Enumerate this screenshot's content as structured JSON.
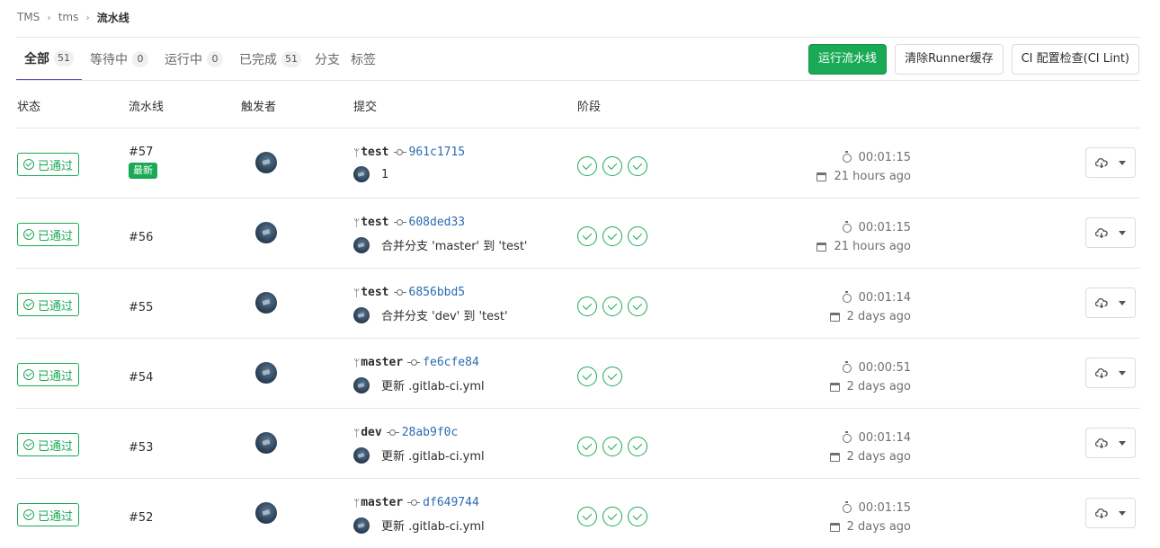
{
  "breadcrumb": {
    "items": [
      "TMS",
      "tms"
    ],
    "current": "流水线"
  },
  "tabs": [
    {
      "label": "全部",
      "count": "51",
      "active": true
    },
    {
      "label": "等待中",
      "count": "0"
    },
    {
      "label": "运行中",
      "count": "0"
    },
    {
      "label": "已完成",
      "count": "51"
    },
    {
      "label": "分支"
    },
    {
      "label": "标签"
    }
  ],
  "actions": {
    "run_pipeline": "运行流水线",
    "clear_cache": "清除Runner缓存",
    "ci_lint": "CI 配置检查(CI Lint)"
  },
  "table": {
    "headers": {
      "status": "状态",
      "pipeline": "流水线",
      "triggerer": "触发者",
      "commit": "提交",
      "stages": "阶段"
    }
  },
  "colors": {
    "success": "#1aaa55",
    "accent": "#6b4fbb"
  },
  "pipelines": [
    {
      "status": "已通过",
      "id": "#57",
      "latest": "最新",
      "ref": "test",
      "sha": "961c1715",
      "message": "1",
      "stages": 3,
      "duration": "00:01:15",
      "ago": "21 hours ago"
    },
    {
      "status": "已通过",
      "id": "#56",
      "ref": "test",
      "sha": "608ded33",
      "message": "合并分支 'master' 到 'test'",
      "stages": 3,
      "duration": "00:01:15",
      "ago": "21 hours ago"
    },
    {
      "status": "已通过",
      "id": "#55",
      "ref": "test",
      "sha": "6856bbd5",
      "message": "合并分支 'dev' 到 'test'",
      "stages": 3,
      "duration": "00:01:14",
      "ago": "2 days ago"
    },
    {
      "status": "已通过",
      "id": "#54",
      "ref": "master",
      "sha": "fe6cfe84",
      "message": "更新 .gitlab-ci.yml",
      "stages": 2,
      "duration": "00:00:51",
      "ago": "2 days ago"
    },
    {
      "status": "已通过",
      "id": "#53",
      "ref": "dev",
      "sha": "28ab9f0c",
      "message": "更新 .gitlab-ci.yml",
      "stages": 3,
      "duration": "00:01:14",
      "ago": "2 days ago"
    },
    {
      "status": "已通过",
      "id": "#52",
      "ref": "master",
      "sha": "df649744",
      "message": "更新 .gitlab-ci.yml",
      "stages": 3,
      "duration": "00:01:15",
      "ago": "2 days ago"
    }
  ]
}
